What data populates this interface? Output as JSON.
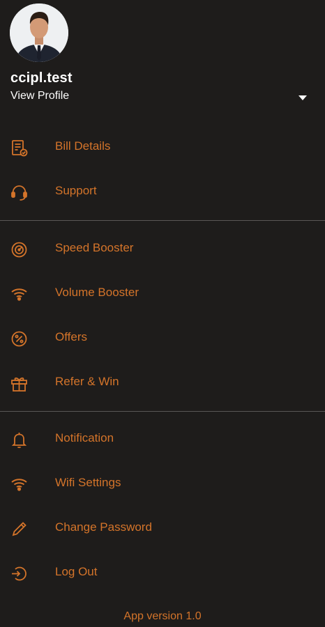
{
  "accent_color": "#d4742a",
  "background_color": "#1e1c1b",
  "profile": {
    "username": "ccipl.test",
    "view_profile_label": "View Profile",
    "avatar_icon": "user-avatar-photo",
    "dropdown_icon": "caret-down-icon"
  },
  "menu": {
    "section1": [
      {
        "label": "Bill Details",
        "icon": "bill-icon"
      },
      {
        "label": "Support",
        "icon": "headset-icon"
      }
    ],
    "section2": [
      {
        "label": "Speed Booster",
        "icon": "speed-icon"
      },
      {
        "label": "Volume Booster",
        "icon": "wifi-icon"
      },
      {
        "label": "Offers",
        "icon": "percent-icon"
      },
      {
        "label": "Refer & Win",
        "icon": "gift-icon"
      }
    ],
    "section3": [
      {
        "label": "Notification",
        "icon": "bell-icon"
      },
      {
        "label": "Wifi Settings",
        "icon": "wifi-icon"
      },
      {
        "label": "Change Password",
        "icon": "pencil-icon"
      },
      {
        "label": "Log Out",
        "icon": "logout-icon"
      }
    ]
  },
  "footer": {
    "version_label": "App version 1.0"
  }
}
